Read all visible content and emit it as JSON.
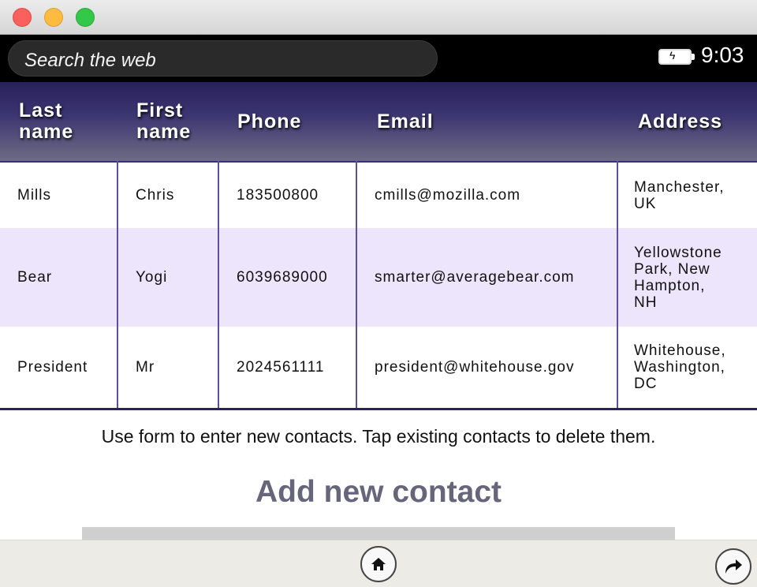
{
  "search": {
    "placeholder": "Search the web"
  },
  "status": {
    "time": "9:03",
    "battery_icon": "battery-charging-icon"
  },
  "table": {
    "headers": {
      "last_line1": "Last",
      "last_line2": "name",
      "first_line1": "First",
      "first_line2": "name",
      "phone": "Phone",
      "email": "Email",
      "address": "Address"
    },
    "rows": [
      {
        "last": "Mills",
        "first": "Chris",
        "phone": "183500800",
        "email": "cmills@mozilla.com",
        "address_lines": [
          "Manchester,",
          "UK"
        ]
      },
      {
        "last": "Bear",
        "first": "Yogi",
        "phone": "6039689000",
        "email": "smarter@averagebear.com",
        "address_lines": [
          "Yellowstone",
          "Park, New",
          "Hampton,",
          "NH"
        ]
      },
      {
        "last": "President",
        "first": "Mr",
        "phone": "2024561111",
        "email": "president@whitehouse.gov",
        "address_lines": [
          "Whitehouse,",
          "Washington,",
          "DC"
        ]
      }
    ]
  },
  "help_text": "Use form to enter new contacts. Tap existing contacts to delete them.",
  "form_heading": "Add new contact",
  "nav": {
    "home_icon": "home-icon",
    "redo_icon": "redo-icon"
  },
  "colors": {
    "header_top": "#28215a",
    "header_bottom": "#6e6b85",
    "row_alt": "#ece5fb",
    "heading": "#66657a"
  }
}
